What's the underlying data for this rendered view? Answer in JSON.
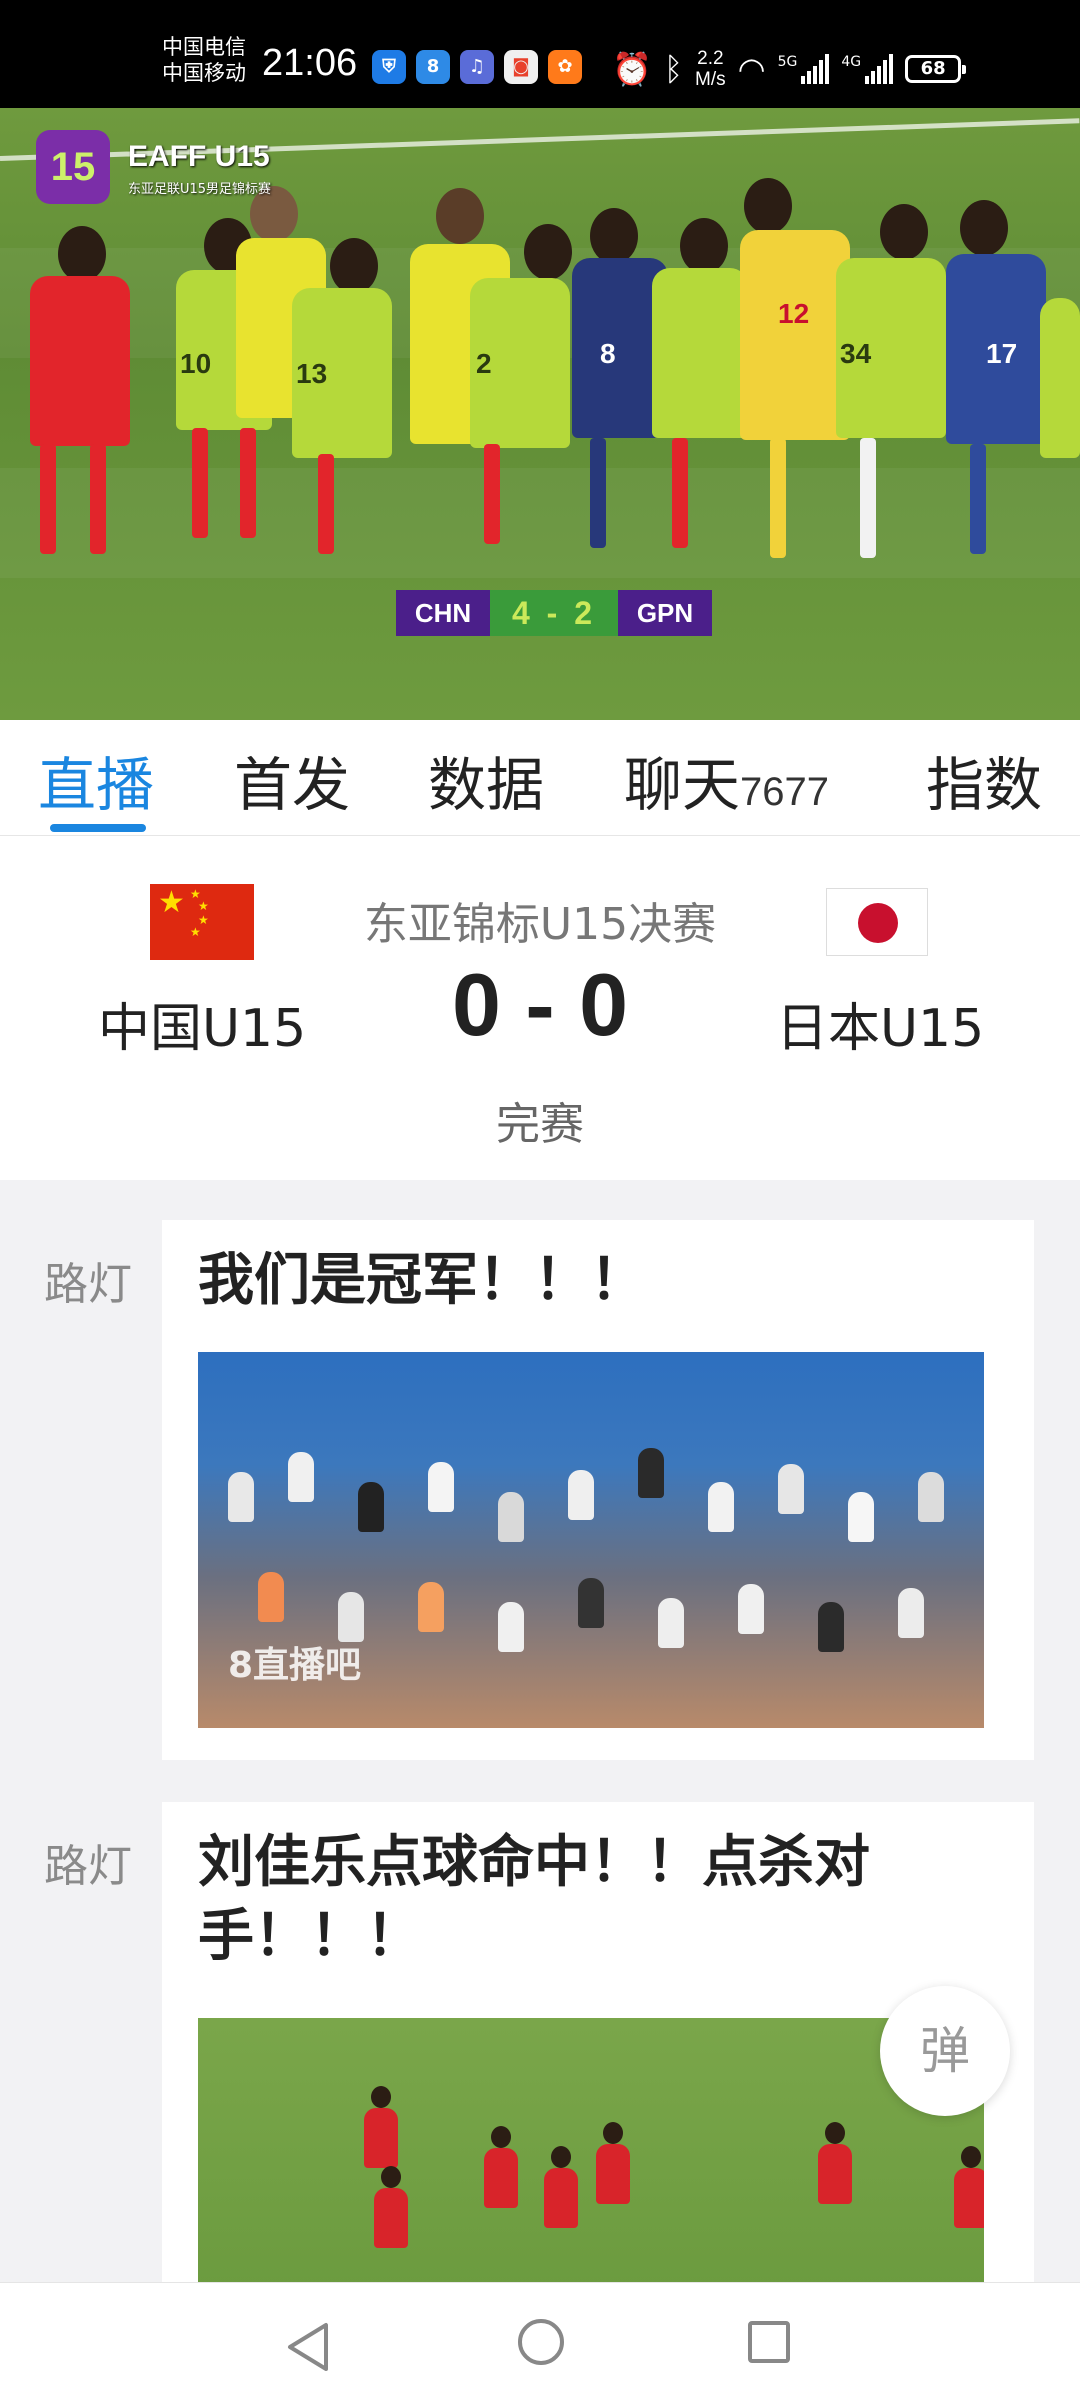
{
  "status_bar": {
    "carrier_1": "中国电信",
    "carrier_2": "中国移动",
    "time": "21:06",
    "net_speed_value": "2.2",
    "net_speed_unit": "M/s",
    "signal_1_label": "5G",
    "signal_2_label": "4G",
    "battery": "68"
  },
  "video": {
    "event_logo": "15",
    "event_title": "EAFF U15",
    "event_subtitle": "东亚足联U15男足锦标赛",
    "scorebug": {
      "home": "CHN",
      "score": "4 - 2",
      "away": "GPN"
    }
  },
  "tabs": [
    {
      "label": "直播"
    },
    {
      "label": "首发"
    },
    {
      "label": "数据"
    },
    {
      "label": "聊天",
      "count": "7677"
    },
    {
      "label": "指数"
    }
  ],
  "match": {
    "competition": "东亚锦标U15决赛",
    "home_team": "中国U15",
    "away_team": "日本U15",
    "score": "0 - 0",
    "status": "完赛"
  },
  "feed": [
    {
      "author": "路灯",
      "title": "我们是冠军！！！",
      "watermark": "8直播吧"
    },
    {
      "author": "路灯",
      "title": "刘佳乐点球命中！！点杀对手！！！"
    }
  ],
  "float_button": "弹",
  "colors": {
    "accent": "#1a86e0",
    "china_red": "#de2910",
    "japan_red": "#c8102e"
  },
  "nav_icons": [
    "back-icon",
    "home-icon",
    "recents-icon"
  ]
}
